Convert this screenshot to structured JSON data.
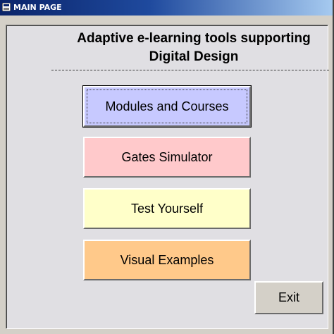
{
  "window": {
    "title": "MAIN PAGE",
    "title_icon": "app-icon"
  },
  "header": {
    "line1": "Adaptive e-learning tools supporting",
    "line2": "Digital Design"
  },
  "buttons": {
    "modules": {
      "label": "Modules and Courses",
      "color": "#c7c9ff"
    },
    "gates": {
      "label": "Gates Simulator",
      "color": "#ffc9cb"
    },
    "test": {
      "label": "Test Yourself",
      "color": "#ffffc9"
    },
    "visual": {
      "label": "Visual Examples",
      "color": "#ffc98a"
    },
    "exit": {
      "label": "Exit",
      "color": "#d4d0c8"
    }
  },
  "colors": {
    "title_bar": "#0a246a",
    "window_face": "#d4d0c8",
    "client_face": "#e0dfe3"
  }
}
